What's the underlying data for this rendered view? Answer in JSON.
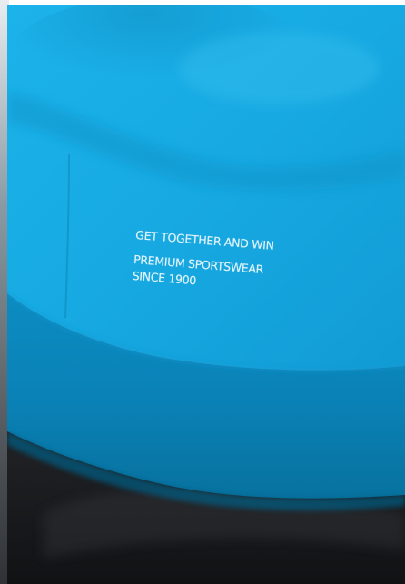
{
  "colors": {
    "shirt_blue": "#16a8e0",
    "shirt_shadow": "#0e86b8",
    "hem_band": "#0a7fb3",
    "shorts_black": "#1c1d20",
    "print_white": "#f3fbff",
    "background": "#ffffff"
  },
  "print": {
    "line1": "GET TOGETHER AND WIN",
    "line2": "PREMIUM SPORTSWEAR",
    "line3": "SINCE 1900"
  }
}
